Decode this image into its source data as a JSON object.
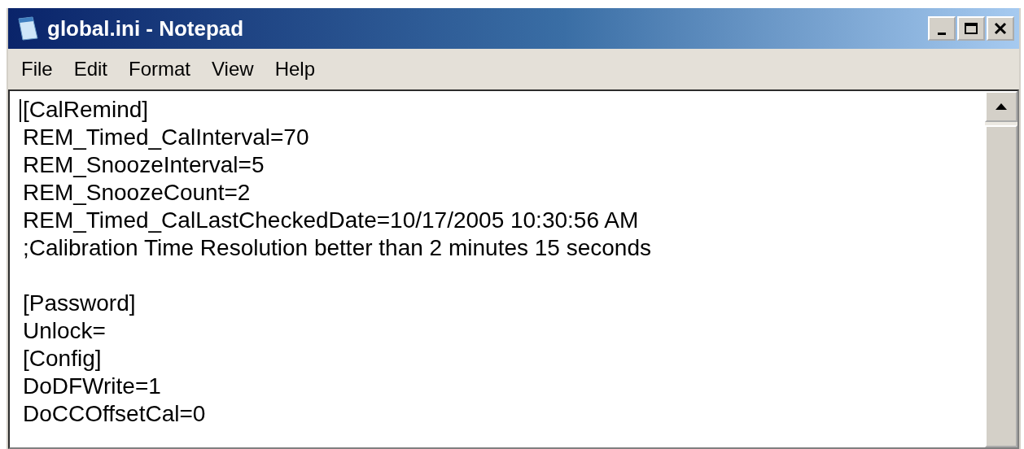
{
  "window": {
    "title": "global.ini - Notepad"
  },
  "menu": [
    "File",
    "Edit",
    "Format",
    "View",
    "Help"
  ],
  "editor": {
    "paragraphs": [
      {
        "lines": [
          "[CalRemind]",
          "REM_Timed_CalInterval=70",
          "REM_SnoozeInterval=5",
          "REM_SnoozeCount=2",
          "REM_Timed_CalLastCheckedDate=10/17/2005 10:30:56 AM",
          ";Calibration Time Resolution better than 2 minutes 15 seconds"
        ]
      },
      {
        "lines": [
          "[Password]",
          "Unlock=",
          "[Config]",
          "DoDFWrite=1",
          "DoCCOffsetCal=0"
        ]
      }
    ]
  }
}
